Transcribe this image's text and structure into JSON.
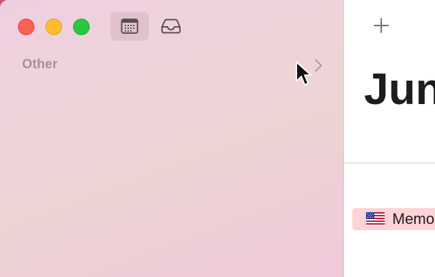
{
  "toolbar": {
    "calendar_icon": "calendar-icon",
    "inbox_icon": "inbox-icon"
  },
  "sidebar": {
    "section_label": "Other"
  },
  "main": {
    "add_icon": "plus-icon",
    "month_title": "Jun",
    "event": {
      "flag": "us-flag-icon",
      "label": "Memo"
    }
  },
  "colors": {
    "close": "#fe5f57",
    "minimize": "#febc2e",
    "zoom": "#28c840",
    "event_bg": "#fcd4d6"
  }
}
